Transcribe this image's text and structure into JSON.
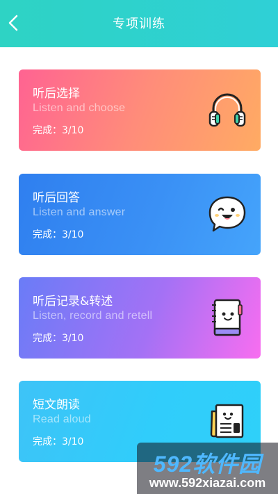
{
  "header": {
    "title": "专项训练",
    "back_icon": "chevron-left-icon"
  },
  "cards": [
    {
      "title": "听后选择",
      "subtitle": "Listen and choose",
      "progress": "完成：3/10",
      "icon": "headphones-icon",
      "gradient": [
        "#ff6392",
        "#ffab63"
      ]
    },
    {
      "title": "听后回答",
      "subtitle": "Listen and answer",
      "progress": "完成：3/10",
      "icon": "speech-bubble-face-icon",
      "gradient": [
        "#2f7fef",
        "#45a4fb"
      ]
    },
    {
      "title": "听后记录&转述",
      "subtitle": "Listen, record and retell",
      "progress": "完成：3/10",
      "icon": "notebook-icon",
      "gradient": [
        "#6a7cf7",
        "#f86ef0"
      ]
    },
    {
      "title": "短文朗读",
      "subtitle": "Read aloud",
      "progress": "完成：3/10",
      "icon": "newspaper-icon",
      "gradient": [
        "#3ec3f7",
        "#2fd0f9"
      ]
    }
  ],
  "watermark": {
    "logo": "592软件园",
    "url": "www.592xiazai.com"
  }
}
